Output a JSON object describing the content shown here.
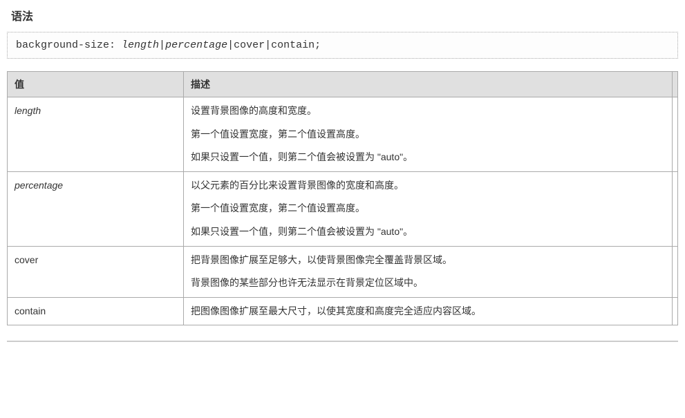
{
  "heading": "语法",
  "code": {
    "prefix": "background-size: ",
    "italicPart": "length",
    "sep1": "|",
    "italicPart2": "percentage",
    "rest": "|cover|contain;"
  },
  "table": {
    "headers": {
      "value": "值",
      "description": "描述"
    },
    "rows": [
      {
        "value": "length",
        "italic": true,
        "desc": [
          "设置背景图像的高度和宽度。",
          "第一个值设置宽度，第二个值设置高度。",
          "如果只设置一个值，则第二个值会被设置为 \"auto\"。"
        ]
      },
      {
        "value": "percentage",
        "italic": true,
        "desc": [
          "以父元素的百分比来设置背景图像的宽度和高度。",
          "第一个值设置宽度，第二个值设置高度。",
          "如果只设置一个值，则第二个值会被设置为 \"auto\"。"
        ]
      },
      {
        "value": "cover",
        "italic": false,
        "desc": [
          "把背景图像扩展至足够大，以使背景图像完全覆盖背景区域。",
          "背景图像的某些部分也许无法显示在背景定位区域中。"
        ]
      },
      {
        "value": "contain",
        "italic": false,
        "desc": [
          "把图像图像扩展至最大尺寸，以使其宽度和高度完全适应内容区域。"
        ]
      }
    ]
  }
}
